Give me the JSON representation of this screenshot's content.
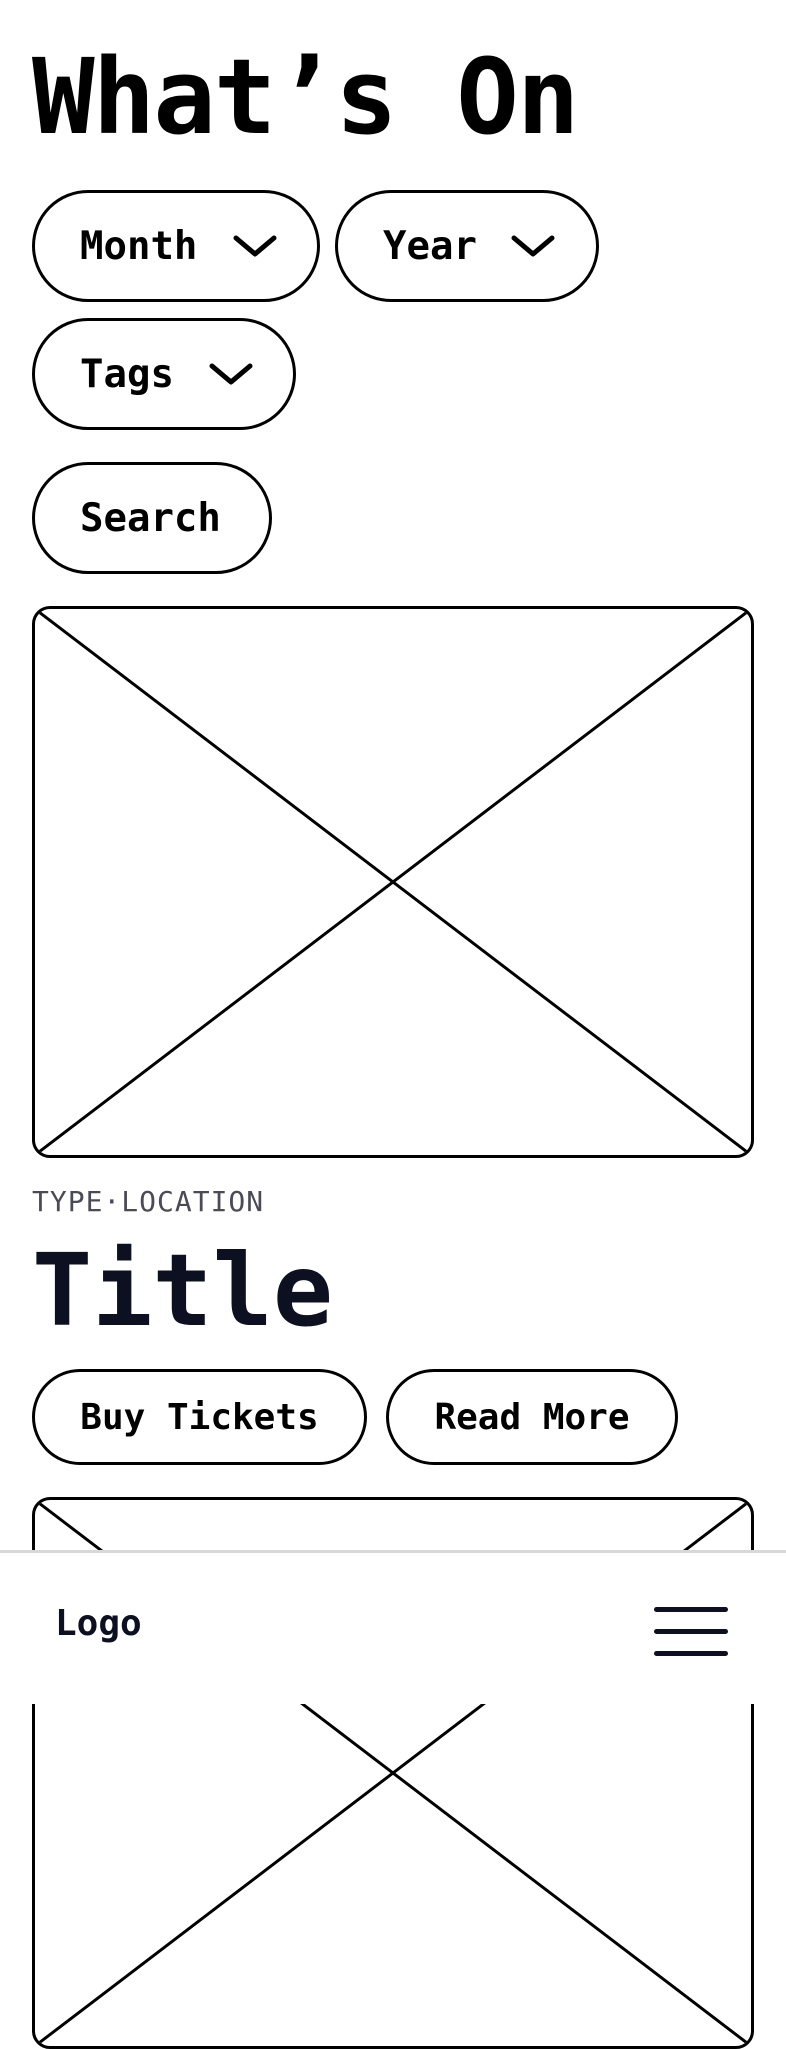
{
  "header": {
    "title": "What’s On"
  },
  "filters": {
    "month_label": "Month",
    "year_label": "Year",
    "tags_label": "Tags",
    "search_label": "Search"
  },
  "cards": [
    {
      "meta": "TYPE·LOCATION",
      "title": "Title",
      "buy_label": "Buy Tickets",
      "read_more_label": "Read More"
    }
  ],
  "footer": {
    "logo": "Logo"
  },
  "icons": {
    "dropdown": "chevron-down-icon",
    "menu": "hamburger-menu-icon",
    "image_placeholder": "image-placeholder-icon"
  },
  "colors": {
    "text": "#000000",
    "title_dark": "#0d1020",
    "meta_gray": "#4b4b57",
    "divider": "#d8d8d8"
  }
}
